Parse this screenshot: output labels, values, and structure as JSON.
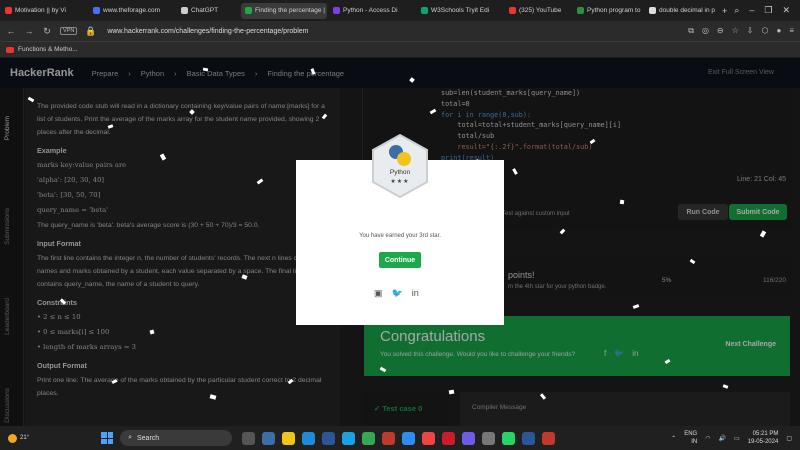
{
  "browser": {
    "tabs": [
      {
        "title": "Motivation || by Vi",
        "color": "#e33"
      },
      {
        "title": "www.theforage.com",
        "color": "#4a6cf7"
      },
      {
        "title": "ChatGPT",
        "color": "#ccc"
      },
      {
        "title": "Finding the percentage |",
        "color": "#1ba94c",
        "active": true
      },
      {
        "title": "Python - Access Di",
        "color": "#7b3fe4"
      },
      {
        "title": "W3Schools Tryit Edi",
        "color": "#04aa6d"
      },
      {
        "title": "(325) YouTube",
        "color": "#e33"
      },
      {
        "title": "Python program to",
        "color": "#2f8d46"
      },
      {
        "title": "double decimal in p",
        "color": "#ddd"
      }
    ],
    "new_tab": "+",
    "vpn": "VPN",
    "url": "www.hackerrank.com/challenges/finding-the-percentage/problem",
    "bookmark": "Functions & Metho..."
  },
  "header": {
    "logo": "HackerRank",
    "crumbs": [
      "Prepare",
      "›",
      "Python",
      "›",
      "Basic Data Types",
      "›",
      "Finding the percentage"
    ],
    "exit": "Exit Full Screen View"
  },
  "side_tabs": [
    "Problem",
    "Submissions",
    "Leaderboard",
    "Discussions"
  ],
  "problem": {
    "intro": "The provided code stub will read in a dictionary containing key/value pairs of name:[marks] for a list of students. Print the average of the marks array for the student name provided, showing 2 places after the decimal.",
    "example_heading": "Example",
    "example_lines": [
      "marks key:value pairs are",
      "'alpha': [20, 30, 40]",
      "'beta': [30, 50, 70]",
      "query_name = 'beta'"
    ],
    "example_result": "The query_name is 'beta'. beta's average score is (30 + 50 + 70)/3 = 50.0.",
    "input_heading": "Input Format",
    "input_text": "The first line contains the integer n, the number of students' records. The next n lines contain the names and marks obtained by a student, each value separated by a space. The final line contains query_name, the name of a student to query.",
    "constraints_heading": "Constraints",
    "constraints": [
      "2 ≤ n ≤ 10",
      "0 ≤ marks[i] ≤ 100",
      "length of marks arrays = 3"
    ],
    "output_heading": "Output Format",
    "output_text": "Print one line: The average of the marks obtained by the particular student correct to 2 decimal places."
  },
  "editor": {
    "code_lines": [
      "sub=len(student_marks[query_name])",
      "total=0",
      "for i in range(0,sub):",
      "    total=total+student_marks[query_name][i]",
      "    total/sub",
      "    result=\"{:.2f}\".format(total/sub)",
      "print(result)"
    ],
    "position": "Line: 21 Col: 45",
    "test_label": "Test against custom input",
    "run_button": "Run Code",
    "submit_button": "Submit Code"
  },
  "points": {
    "title": "points!",
    "subtitle": "m the 4th star for your python badge.",
    "percent": "5%",
    "score": "116/220"
  },
  "congrats": {
    "title": "Congratulations",
    "subtitle": "You solved this challenge. Would you like to challenge your friends?",
    "next": "Next Challenge"
  },
  "testcase": {
    "label": "Test case 0",
    "compiler": "Compiler Message"
  },
  "modal": {
    "badge_name": "Python",
    "stars": "★★★",
    "message": "You have earned your 3rd star.",
    "continue_button": "Continue",
    "share_icons": [
      "facebook-icon",
      "twitter-icon",
      "linkedin-icon"
    ],
    "accent": "#1ba94c"
  },
  "taskbar": {
    "weather": "21°",
    "search_placeholder": "Search",
    "lang_top": "ENG",
    "lang_bottom": "IN",
    "time": "05:21 PM",
    "date": "19-05-2024"
  }
}
